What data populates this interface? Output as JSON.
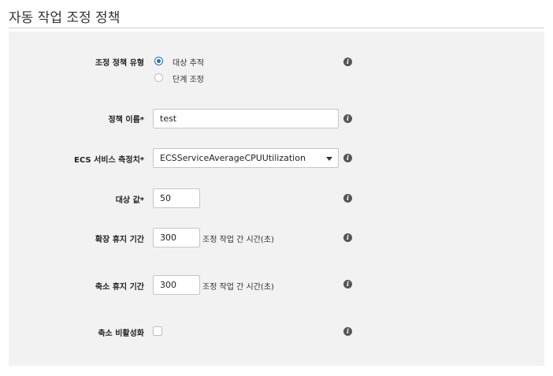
{
  "page": {
    "title": "자동 작업 조정 정책"
  },
  "form": {
    "policy_type": {
      "label": "조정 정책 유형",
      "options": [
        "대상 추적",
        "단계 조정"
      ],
      "selected": "대상 추적"
    },
    "policy_name": {
      "label": "정책 이름*",
      "value": "test"
    },
    "ecs_metric": {
      "label": "ECS 서비스 측정치*",
      "value": "ECSServiceAverageCPUUtilization"
    },
    "target_value": {
      "label": "대상 값*",
      "value": "50"
    },
    "scale_out_cooldown": {
      "label": "확장 휴지 기간",
      "value": "300",
      "hint": "조정 작업 간 시간(초)"
    },
    "scale_in_cooldown": {
      "label": "축소 휴지 기간",
      "value": "300",
      "hint": "조정 작업 간 시간(초)"
    },
    "disable_scale_in": {
      "label": "축소 비활성화",
      "checked": false
    }
  },
  "icons": {
    "info": "info-icon",
    "info_glyph": "i"
  },
  "colors": {
    "radio_selected": "#1f6fc1",
    "panel_bg": "#f2f2f2"
  }
}
